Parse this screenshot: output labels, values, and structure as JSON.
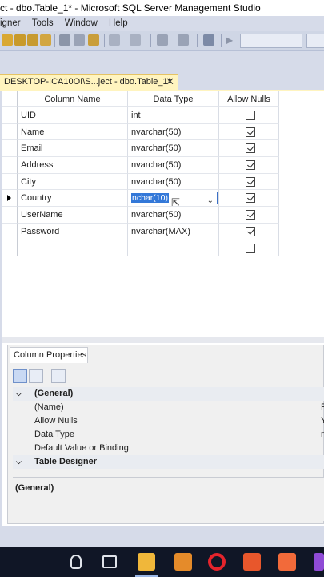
{
  "window": {
    "title": "ct - dbo.Table_1* - Microsoft SQL Server Management Studio"
  },
  "menu": {
    "items": [
      "igner",
      "Tools",
      "Window",
      "Help"
    ]
  },
  "document_tab": {
    "label": "DESKTOP-ICA10OI\\S...ject - dbo.Table_1*",
    "close_glyph": "✕"
  },
  "table": {
    "headers": {
      "column_name": "Column Name",
      "data_type": "Data Type",
      "allow_nulls": "Allow Nulls"
    },
    "rows": [
      {
        "name": "UID",
        "type": "int",
        "allow_nulls": false
      },
      {
        "name": "Name",
        "type": "nvarchar(50)",
        "allow_nulls": true
      },
      {
        "name": "Email",
        "type": "nvarchar(50)",
        "allow_nulls": true
      },
      {
        "name": "Address",
        "type": "nvarchar(50)",
        "allow_nulls": true
      },
      {
        "name": "City",
        "type": "nvarchar(50)",
        "allow_nulls": true
      },
      {
        "name": "Country",
        "type": "nchar(10)",
        "allow_nulls": true,
        "editing": true
      },
      {
        "name": "UserName",
        "type": "nvarchar(50)",
        "allow_nulls": true
      },
      {
        "name": "Password",
        "type": "nvarchar(MAX)",
        "allow_nulls": true
      },
      {
        "name": "",
        "type": "",
        "allow_nulls": false
      }
    ]
  },
  "column_properties": {
    "tab_label": "Column Properties",
    "general_category": "(General)",
    "properties": [
      {
        "name": "(Name)",
        "value": "Pa"
      },
      {
        "name": "Allow Nulls",
        "value": "Ye"
      },
      {
        "name": "Data Type",
        "value": "nv"
      },
      {
        "name": "Default Value or Binding",
        "value": ""
      }
    ],
    "designer_category": "Table Designer",
    "description_title": "(General)"
  },
  "icons": {
    "row_selector": "row-selector-arrow-icon",
    "dropdown": "chevron-down-icon",
    "categorized": "categorized-icon",
    "alphabetical": "alphabetical-icon",
    "property_pages": "property-pages-icon"
  },
  "colors": {
    "tab_active": "#fff4bf",
    "selection": "#3378d8",
    "window_bg": "#d6dbe9",
    "taskbar": "#101626"
  }
}
